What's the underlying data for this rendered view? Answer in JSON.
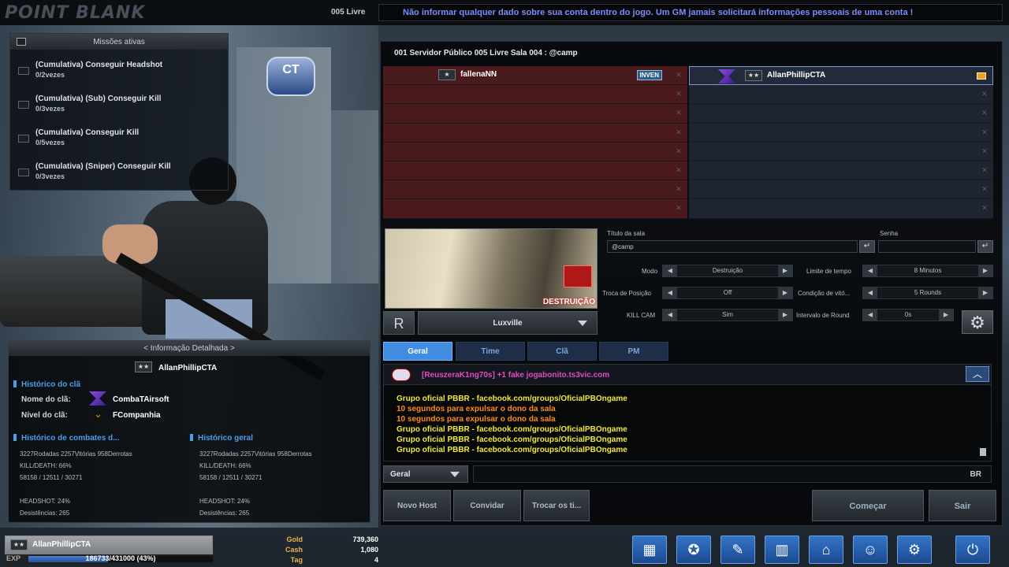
{
  "header": {
    "logo": "POINT BLANK",
    "server_label": "005 Livre",
    "ticker": "Não informar qualquer dado sobre sua conta dentro do jogo. Um GM jamais solicitará informações pessoais de uma conta !"
  },
  "missions": {
    "title": "Missões ativas",
    "items": [
      {
        "title": "(Cumulativa)  Conseguir Headshot",
        "progress": "0/2vezes"
      },
      {
        "title": "(Cumulativa) (Sub)  Conseguir Kill",
        "progress": "0/3vezes"
      },
      {
        "title": "(Cumulativa)  Conseguir Kill",
        "progress": "0/5vezes"
      },
      {
        "title": "(Cumulativa) (Sniper)  Conseguir Kill",
        "progress": "0/3vezes"
      }
    ]
  },
  "ct_badge": "CT",
  "info": {
    "title": "< Informação Detalhada >",
    "player_name": "AllanPhillipCTA",
    "clan_history_title": "Histórico do clã",
    "clan_name_label": "Nome do clã:",
    "clan_name": "CombaTAirsoft",
    "clan_level_label": "Nível do clã:",
    "clan_level": "FCompanhia",
    "combat_title": "Histórico de combates d...",
    "general_title": "Histórico geral",
    "combat": {
      "rounds": "3227Rodadas 2257Vitórias 958Derrotas",
      "kd": "KILL/DEATH:   66%",
      "kills": "58158 / 12511 / 30271",
      "hs": "HEADSHOT:  24%",
      "quits": "Desistências: 265"
    },
    "general": {
      "rounds": "3227Rodadas 2257Vitórias 958Derrotas",
      "kd": "KILL/DEATH:   66%",
      "kills": "58158 / 12511 / 30271",
      "hs": "HEADSHOT:  24%",
      "quits": "Desistências: 265"
    }
  },
  "player_bar": {
    "name": "AllanPhillipCTA",
    "exp_label": "EXP",
    "exp_text": "186733/431000 (43%)",
    "exp_progress": 0.43
  },
  "currency": {
    "gold_label": "Gold",
    "gold": "739,360",
    "cash_label": "Cash",
    "cash": "1,080",
    "tag_label": "Tag",
    "tag": "4"
  },
  "room": {
    "title": "001 Servidor Público 005 Livre Sala 004 : @camp",
    "red_player": "fallenaNN",
    "red_status": "INVEN",
    "blue_player": "AllanPhillipCTA",
    "close_glyph": "✕",
    "map_mode_tag": "DESTRUIÇÃO",
    "r_button": "R",
    "map_name": "Luxville",
    "room_title_label": "Título da sala",
    "room_title_value": "@camp",
    "password_label": "Senha",
    "password_value": "",
    "options": {
      "mode_label": "Modo",
      "mode": "Destruição",
      "time_label": "Limite de tempo",
      "time": "8 Minutos",
      "swap_label": "Troca de Posição",
      "swap": "Off",
      "win_label": "Condição de vitó...",
      "win": "5 Rounds",
      "killcam_label": "KILL CAM",
      "killcam": "Sim",
      "interval_label": "Intervalo de Round",
      "interval": "0s"
    }
  },
  "chat": {
    "tabs": [
      "Geral",
      "Time",
      "Clã",
      "PM"
    ],
    "megaphone": "[ReuszeraK1ng70s] +1 fake jogabonito.ts3vic.com",
    "lines": [
      {
        "text": "Grupo oficial PBBR - facebook.com/groups/OficialPBOngame",
        "color": "#f0e83c"
      },
      {
        "text": "10 segundos para expulsar o dono da sala",
        "color": "#ff8a1c"
      },
      {
        "text": "10 segundos para expulsar o dono da sala",
        "color": "#ff8a1c"
      },
      {
        "text": "Grupo oficial PBBR - facebook.com/groups/OficialPBOngame",
        "color": "#f0e83c"
      },
      {
        "text": "Grupo oficial PBBR - facebook.com/groups/OficialPBOngame",
        "color": "#f0e83c"
      },
      {
        "text": "Grupo oficial PBBR - facebook.com/groups/OficialPBOngame",
        "color": "#f0e83c"
      }
    ],
    "channel": "Geral",
    "lang": "BR"
  },
  "actions": {
    "new_host": "Novo Host",
    "invite": "Convidar",
    "switch": "Trocar os ti...",
    "start": "Começar",
    "exit": "Sair"
  },
  "menu_icons": [
    "calendar-icon",
    "emblem-icon",
    "notes-icon",
    "inventory-icon",
    "shop-basket-icon",
    "friends-icon",
    "settings-icon",
    "power-icon"
  ]
}
